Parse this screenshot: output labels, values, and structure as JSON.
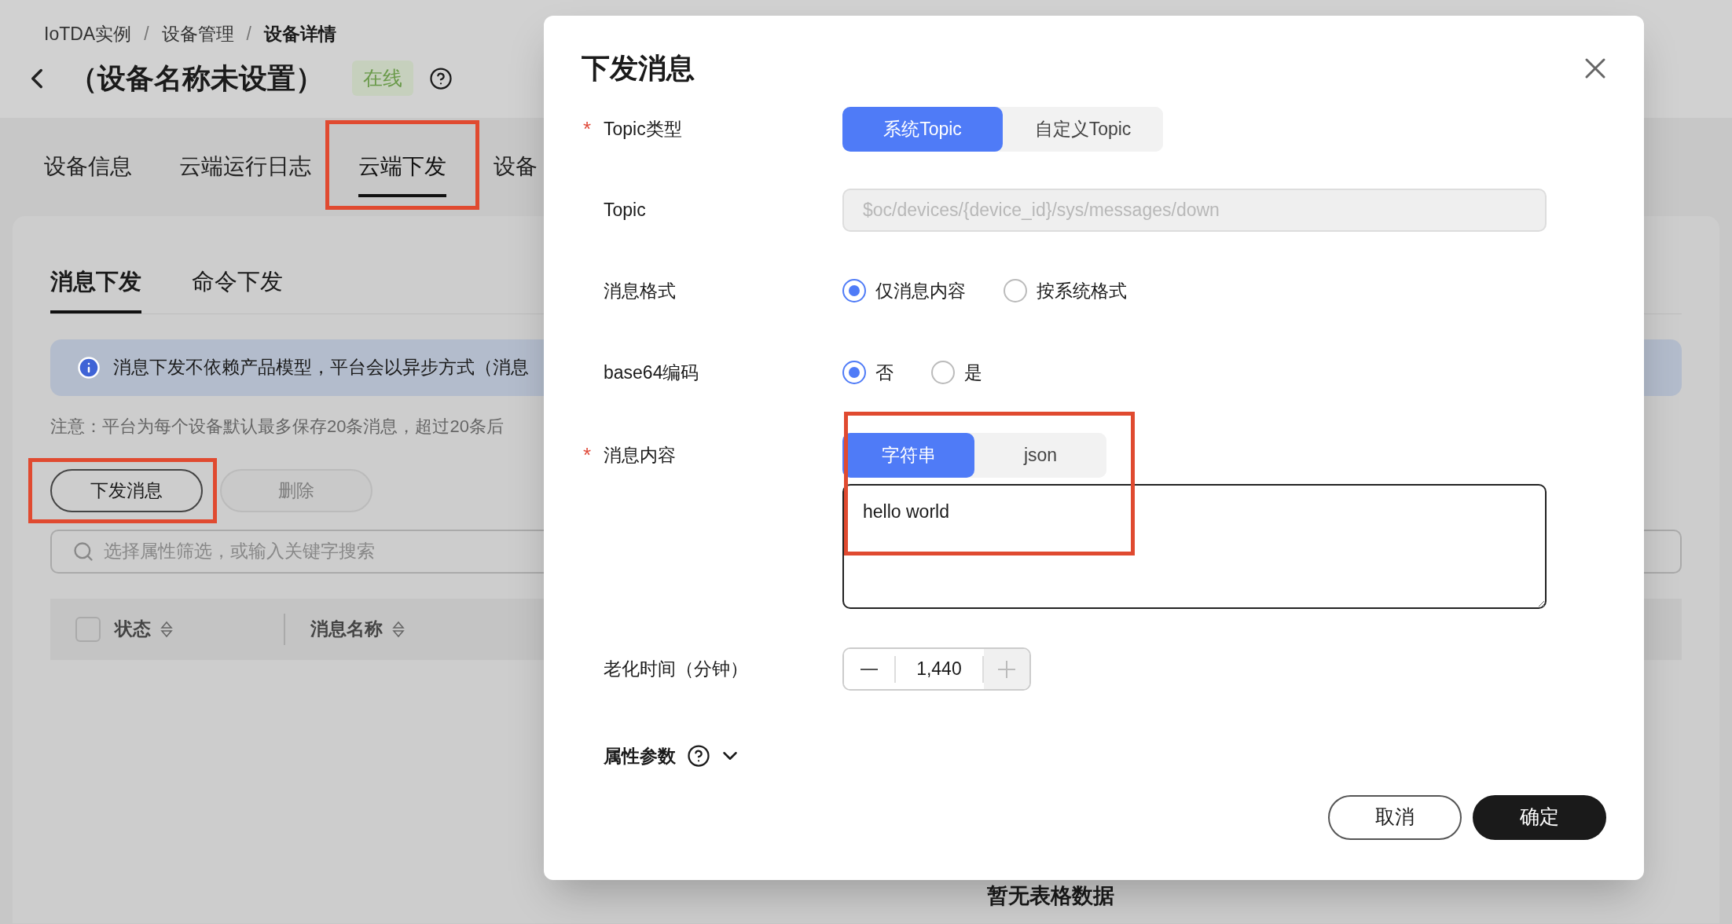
{
  "breadcrumb": {
    "separator": "/",
    "items": [
      {
        "label": "IoTDA实例",
        "current": false
      },
      {
        "label": "设备管理",
        "current": false
      },
      {
        "label": "设备详情",
        "current": true
      }
    ]
  },
  "device": {
    "name": "（设备名称未设置）",
    "status": "在线",
    "online": true
  },
  "main_tabs": [
    {
      "label": "设备信息",
      "selected": false,
      "highlighted": false
    },
    {
      "label": "云端运行日志",
      "selected": false,
      "highlighted": false
    },
    {
      "label": "云端下发",
      "selected": true,
      "highlighted": true
    },
    {
      "label": "设备",
      "selected": false,
      "highlighted": false
    }
  ],
  "sub_tabs": [
    {
      "label": "消息下发",
      "selected": true
    },
    {
      "label": "命令下发",
      "selected": false
    }
  ],
  "info": "消息下发不依赖产品模型，平台会以异步方式（消息",
  "note": "注意：平台为每个设备默认最多保存20条消息，超过20条后",
  "actions": [
    {
      "label": "下发消息",
      "disabled": false,
      "highlighted": true
    },
    {
      "label": "删除",
      "disabled": true,
      "highlighted": false
    }
  ],
  "search": {
    "placeholder": "选择属性筛选，或输入关键字搜索"
  },
  "table": {
    "select_all_checked": false,
    "columns": [
      {
        "label": "状态"
      },
      {
        "label": "消息名称"
      }
    ],
    "empty_text": "暂无表格数据"
  },
  "dialog": {
    "title": "下发消息",
    "required_mark": "*",
    "topic_type": {
      "label": "Topic类型",
      "required": true,
      "options": [
        {
          "label": "系统Topic",
          "selected": true
        },
        {
          "label": "自定义Topic",
          "selected": false
        }
      ]
    },
    "topic": {
      "label": "Topic",
      "value": "$oc/devices/{device_id}/sys/messages/down",
      "disabled": true
    },
    "message_format": {
      "label": "消息格式",
      "options": [
        {
          "label": "仅消息内容",
          "selected": true
        },
        {
          "label": "按系统格式",
          "selected": false
        }
      ]
    },
    "base64": {
      "label": "base64编码",
      "options": [
        {
          "label": "否",
          "selected": true
        },
        {
          "label": "是",
          "selected": false
        }
      ]
    },
    "message_content": {
      "label": "消息内容",
      "required": true,
      "highlighted": true,
      "modes": [
        {
          "label": "字符串",
          "selected": true
        },
        {
          "label": "json",
          "selected": false
        }
      ],
      "value": "hello world"
    },
    "aging": {
      "label": "老化时间（分钟）",
      "value": "1,440",
      "decrement_disabled": false,
      "increment_disabled": true
    },
    "attributes": {
      "label": "属性参数",
      "expanded": false
    },
    "buttons": [
      {
        "label": "取消",
        "kind": "secondary"
      },
      {
        "label": "确定",
        "kind": "primary"
      }
    ]
  }
}
